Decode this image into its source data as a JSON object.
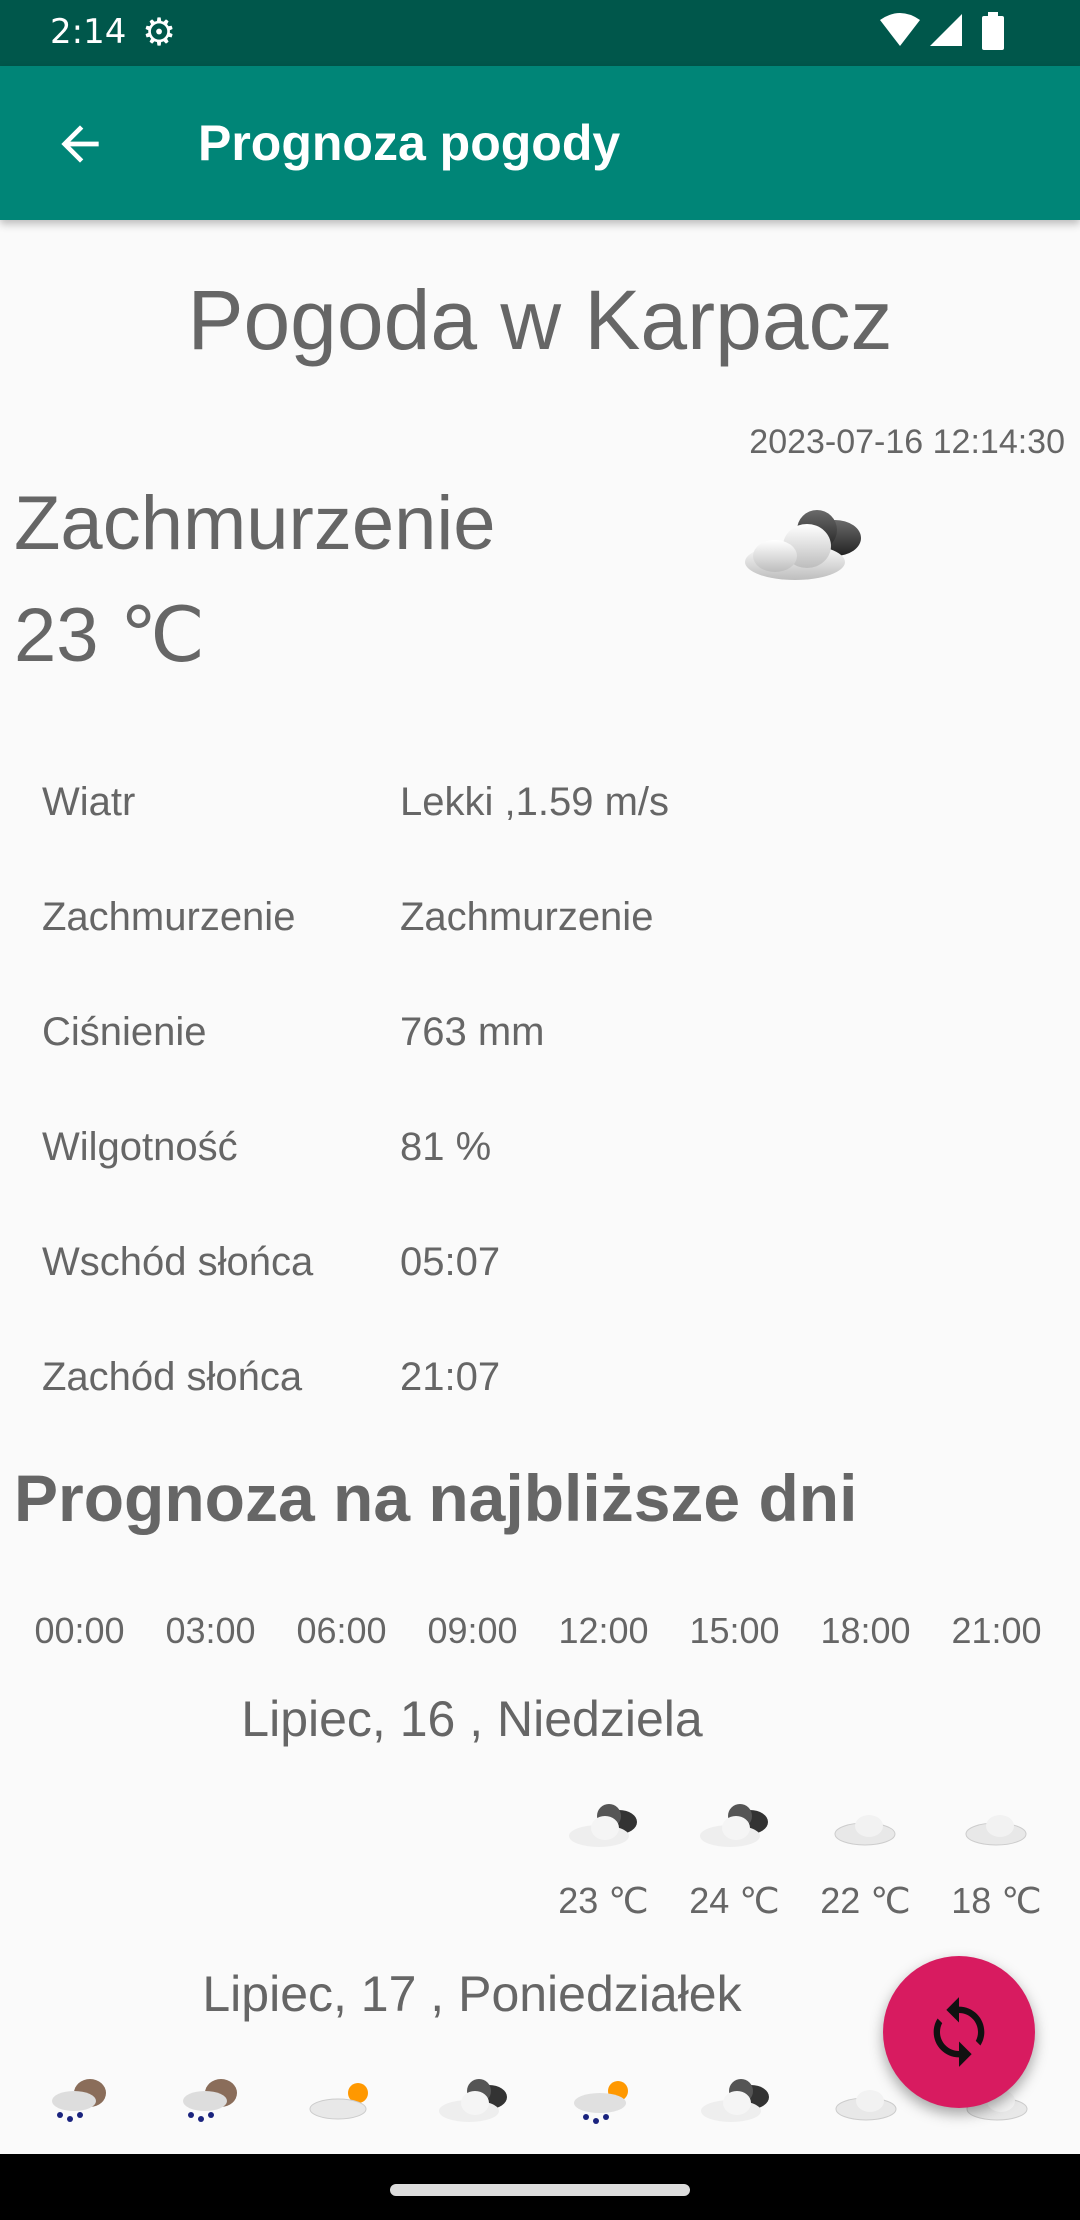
{
  "status_bar": {
    "time": "2:14",
    "icons": [
      "settings-gear-icon",
      "wifi-icon",
      "signal-icon",
      "battery-icon"
    ]
  },
  "app_bar": {
    "title": "Prognoza pogody",
    "back_icon": "arrow-back-icon",
    "color": "#008577"
  },
  "current": {
    "heading": "Pogoda w Karpacz",
    "timestamp": "2023-07-16 12:14:30",
    "condition": "Zachmurzenie",
    "temperature": "23 ℃",
    "icon": "cloudy-icon",
    "details": [
      {
        "label": "Wiatr",
        "value": "Lekki ,1.59 m/s"
      },
      {
        "label": "Zachmurzenie",
        "value": "Zachmurzenie"
      },
      {
        "label": "Ciśnienie",
        "value": "763 mm"
      },
      {
        "label": "Wilgotność",
        "value": "81 %"
      },
      {
        "label": "Wschód słońca",
        "value": "05:07"
      },
      {
        "label": "Zachód słońca",
        "value": "21:07"
      }
    ]
  },
  "forecast": {
    "title": "Prognoza na najbliższe dni",
    "hours": [
      "00:00",
      "03:00",
      "06:00",
      "09:00",
      "12:00",
      "15:00",
      "18:00",
      "21:00"
    ],
    "days": [
      {
        "label": "Lipiec, 16 , Niedziela",
        "slots": [
          {
            "hour": "12:00",
            "icon": "dark-cloud-icon",
            "temp": "23 ℃"
          },
          {
            "hour": "15:00",
            "icon": "dark-cloud-icon",
            "temp": "24 ℃"
          },
          {
            "hour": "18:00",
            "icon": "cloud-icon",
            "temp": "22 ℃"
          },
          {
            "hour": "21:00",
            "icon": "cloud-icon",
            "temp": "18 ℃"
          }
        ]
      },
      {
        "label": "Lipiec, 17 , Poniedziałek",
        "slots": [
          {
            "hour": "00:00",
            "icon": "rain-cloud-icon"
          },
          {
            "hour": "03:00",
            "icon": "rain-cloud-icon"
          },
          {
            "hour": "06:00",
            "icon": "sun-cloud-icon"
          },
          {
            "hour": "09:00",
            "icon": "dark-cloud-icon"
          },
          {
            "hour": "12:00",
            "icon": "sun-rain-cloud-icon"
          },
          {
            "hour": "15:00",
            "icon": "dark-cloud-icon"
          },
          {
            "hour": "18:00",
            "icon": "cloud-icon"
          },
          {
            "hour": "21:00",
            "icon": "cloud-icon"
          }
        ]
      }
    ]
  },
  "fab": {
    "icon": "refresh-icon",
    "color": "#d81b60"
  }
}
